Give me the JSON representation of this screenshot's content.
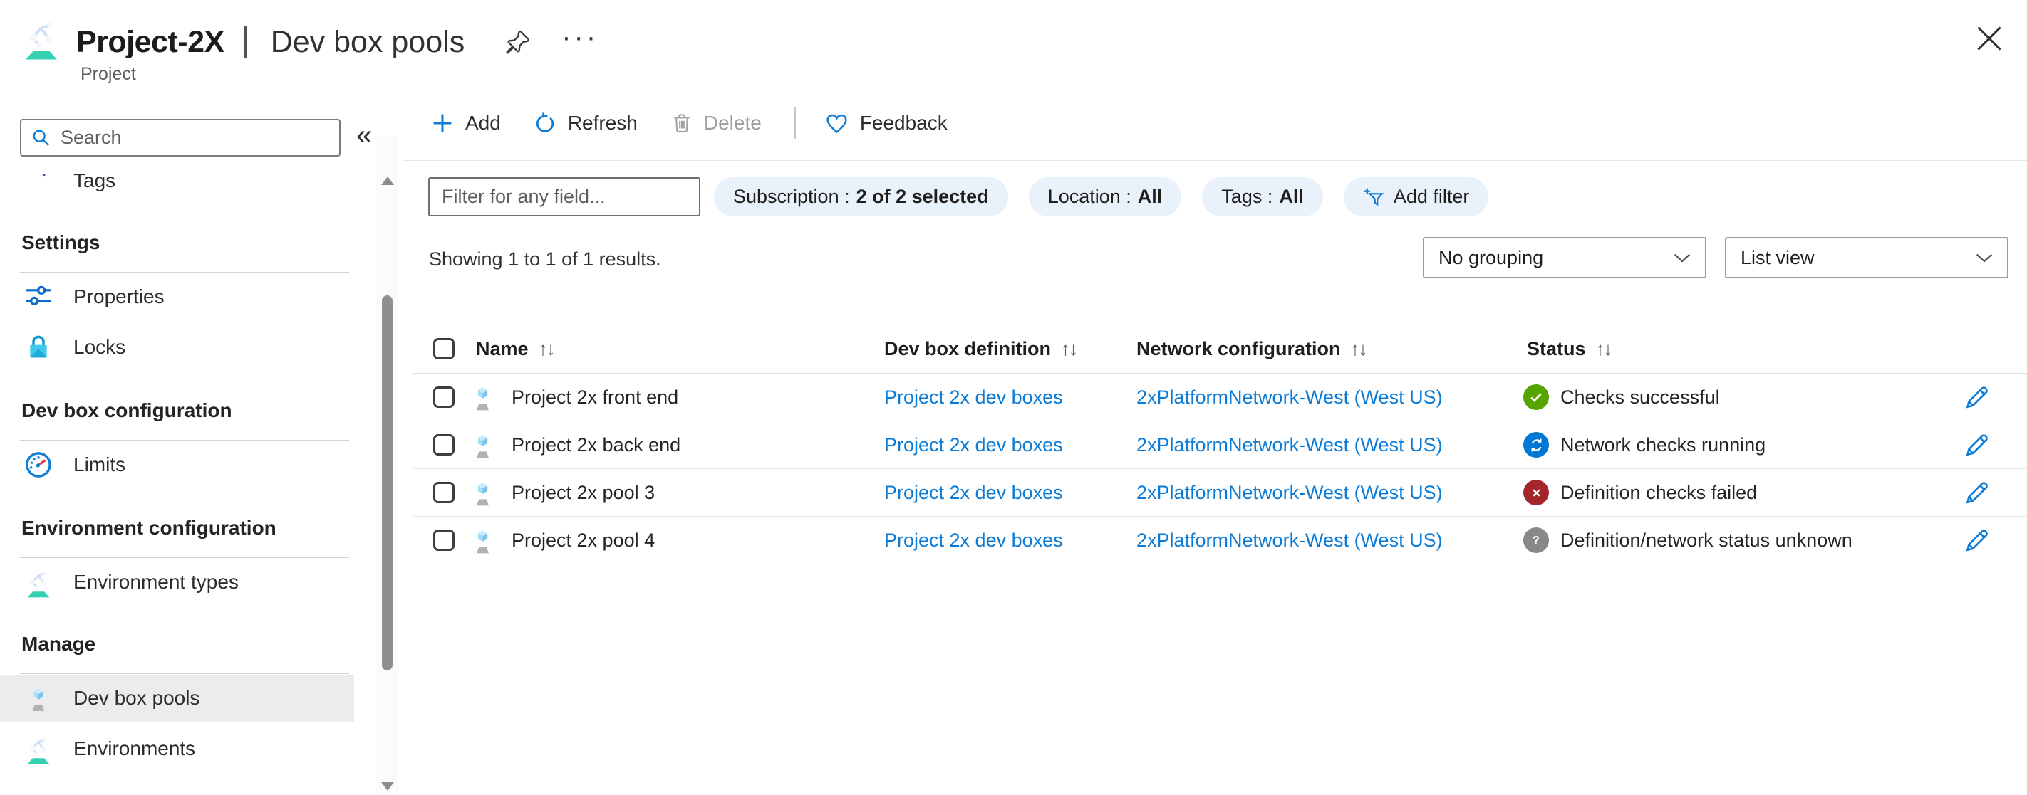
{
  "header": {
    "title": "Project-2X",
    "page": "Dev box pools",
    "resource_type": "Project",
    "more_icon": "···"
  },
  "sidebar": {
    "search_placeholder": "Search",
    "collapse_icon": "«",
    "groups": [
      {
        "header": "",
        "items": [
          {
            "label": "Tags",
            "icon": "tag-icon"
          }
        ]
      },
      {
        "header": "Settings",
        "items": [
          {
            "label": "Properties",
            "icon": "sliders-icon"
          },
          {
            "label": "Locks",
            "icon": "lock-icon"
          }
        ]
      },
      {
        "header": "Dev box configuration",
        "items": [
          {
            "label": "Limits",
            "icon": "gauge-icon"
          }
        ]
      },
      {
        "header": "Environment configuration",
        "items": [
          {
            "label": "Environment types",
            "icon": "globe-icon"
          }
        ]
      },
      {
        "header": "Manage",
        "items": [
          {
            "label": "Dev box pools",
            "icon": "devbox-icon",
            "active": true
          },
          {
            "label": "Environments",
            "icon": "globe-icon"
          }
        ]
      }
    ]
  },
  "toolbar": {
    "add": "Add",
    "refresh": "Refresh",
    "delete": "Delete",
    "feedback": "Feedback"
  },
  "filters": {
    "field_placeholder": "Filter for any field...",
    "pills": [
      {
        "label": "Subscription :",
        "value": "2 of 2 selected"
      },
      {
        "label": "Location :",
        "value": "All"
      },
      {
        "label": "Tags :",
        "value": "All"
      }
    ],
    "add_filter": "Add filter"
  },
  "results": {
    "summary": "Showing 1 to 1 of 1 results.",
    "grouping": "No grouping",
    "view": "List view"
  },
  "table": {
    "sort_icon": "↑↓",
    "columns": [
      "Name",
      "Dev box definition",
      "Network configuration",
      "Status"
    ],
    "rows": [
      {
        "name": "Project 2x front end",
        "definition": "Project 2x dev boxes",
        "network": "2xPlatformNetwork-West (West US)",
        "status": "Checks successful",
        "status_kind": "success"
      },
      {
        "name": "Project 2x back end",
        "definition": "Project 2x dev boxes",
        "network": "2xPlatformNetwork-West (West US)",
        "status": "Network checks running",
        "status_kind": "running"
      },
      {
        "name": "Project 2x pool 3",
        "definition": "Project 2x dev boxes",
        "network": "2xPlatformNetwork-West (West US)",
        "status": "Definition checks failed",
        "status_kind": "failed"
      },
      {
        "name": "Project 2x pool 4",
        "definition": "Project 2x dev boxes",
        "network": "2xPlatformNetwork-West (West US)",
        "status": "Definition/network status unknown",
        "status_kind": "unknown"
      }
    ]
  },
  "icons": {
    "project": "globe-on-stand",
    "pin": "pushpin-outline",
    "more": "ellipsis",
    "close": "x",
    "search": "magnifier",
    "collapse": "double-chevron-left",
    "tag": "purple-tag",
    "properties": "sliders",
    "locks": "lock",
    "limits": "gauge",
    "environment_types": "globe-on-stand",
    "dev_box_pools": "monitor-hexagon",
    "environments": "globe-on-stand",
    "add": "plus",
    "refresh": "circular-arrow",
    "delete": "trash",
    "feedback": "heart-outline",
    "add_filter": "funnel-plus",
    "dropdown": "chevron-down",
    "sort": "arrows-up-down",
    "edit": "pencil",
    "status_success": "check-circle",
    "status_running": "sync-circle",
    "status_failed": "x-circle",
    "status_unknown": "question-circle"
  },
  "colors": {
    "accent": "#0078d4",
    "link": "#0b7bd6",
    "success": "#57a300",
    "error": "#a4262c",
    "running": "#0078d4",
    "unknown": "#8a8886",
    "pill_bg": "#e9f2fa",
    "highlight_bg": "#ececec"
  }
}
